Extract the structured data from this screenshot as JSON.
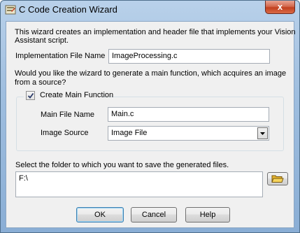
{
  "window": {
    "title": "C Code Creation Wizard",
    "close_label": "x"
  },
  "intro": {
    "line1": "This wizard creates an implementation and header file that implements your Vision",
    "line2": "Assistant script."
  },
  "implementation": {
    "label": "Implementation File Name",
    "value": "ImageProcessing.c"
  },
  "question": {
    "line1": "Would you like the wizard to generate a main function, which acquires an image",
    "line2": "from a source?"
  },
  "main_function": {
    "checkbox_label": "Create Main Function",
    "checked": true,
    "file_label": "Main File Name",
    "file_value": "Main.c",
    "source_label": "Image Source",
    "source_value": "Image File"
  },
  "folder": {
    "label": "Select the folder to which you want to save the generated files.",
    "value": "F:\\"
  },
  "buttons": {
    "ok": "OK",
    "cancel": "Cancel",
    "help": "Help"
  },
  "colors": {
    "accent_folder": "#e8b630",
    "check_mark": "#2b3a67"
  }
}
